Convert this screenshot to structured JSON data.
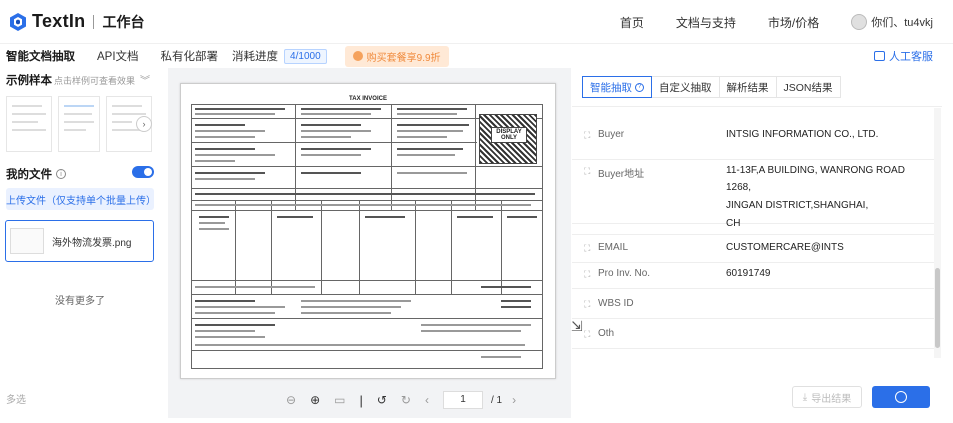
{
  "header": {
    "logo_text": "TextIn",
    "workbench": "工作台",
    "nav": [
      "首页",
      "文档与支持",
      "市场/价格"
    ],
    "user": "你们、tu4vkj"
  },
  "subbar": {
    "tabs": [
      "智能文档抽取",
      "API文档",
      "私有化部署"
    ],
    "usage_label": "消耗进度",
    "usage_count": "4/1000",
    "buy_label": "购买套餐享9.9折",
    "service_label": "人工客服"
  },
  "left": {
    "samples_title": "示例样本",
    "samples_hint": "点击样例可查看效果",
    "myfiles_title": "我的文件",
    "upload_label": "上传文件（仅支持单个批量上传）",
    "file_name": "海外物流发票.png",
    "no_more": "没有更多了",
    "footer": "多选"
  },
  "document": {
    "title": "TAX INVOICE",
    "stamp": "DISPLAY ONLY"
  },
  "viewer": {
    "page": "1",
    "total": "/ 1"
  },
  "right": {
    "tabs": [
      "智能抽取",
      "自定义抽取",
      "解析结果",
      "JSON结果"
    ],
    "fields": [
      {
        "key": "Buyer",
        "value": "INTSIG INFORMATION CO., LTD."
      },
      {
        "key": "Buyer地址",
        "value": "11-13F,A BUILDING, WANRONG ROAD 1268,",
        "value2": "JINGAN DISTRICT,SHANGHAI,",
        "value3": "CH"
      },
      {
        "key": "EMAIL",
        "value": "CUSTOMERCARE@INTS"
      },
      {
        "key": "Pro Inv. No.",
        "value": "60191749"
      },
      {
        "key": "WBS ID",
        "value": ""
      },
      {
        "key": "Oth",
        "value": ""
      }
    ],
    "export_label": "导出结果"
  },
  "colors": {
    "accent": "#2b6fe8",
    "buy_orange": "#f08a3c"
  }
}
